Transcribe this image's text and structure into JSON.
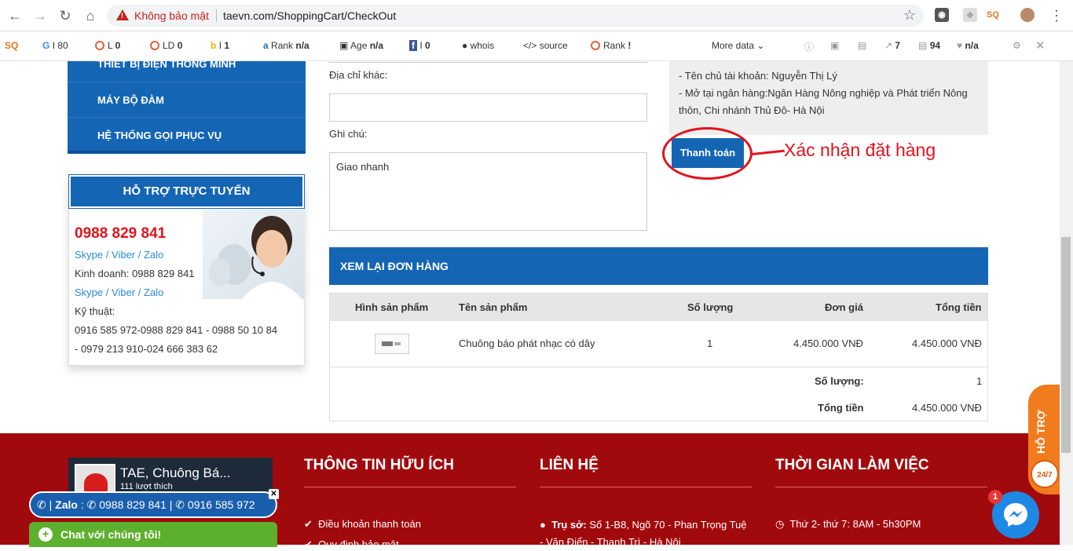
{
  "browser": {
    "insecure_label": "Không bảo mật",
    "url": "taevn.com/ShoppingCart/CheckOut"
  },
  "seo_toolbar": {
    "google": "I 80",
    "links": "L",
    "links_val": "0",
    "ld": "LD",
    "ld_val": "0",
    "bing": "I",
    "bing_val": "1",
    "rank_label": "Rank",
    "rank_val": "n/a",
    "age_label": "Age",
    "age_val": "n/a",
    "fb": "I",
    "fb_val": "0",
    "whois": "whois",
    "source": "source",
    "rank2": "Rank",
    "rank2_val": "!",
    "more": "More data",
    "ext_count": "7",
    "pages": "94",
    "heart": "n/a"
  },
  "sidebar": {
    "menu": [
      "THIẾT BỊ ĐIỆN THÔNG MINH",
      "MÁY BỘ ĐÀM",
      "HỆ THỐNG GỌI PHỤC VỤ"
    ],
    "support_title": "HỖ TRỢ TRỰC TUYẾN",
    "hotline": "0988 829 841",
    "skype": "Skype",
    "viber": "Viber",
    "zalo": "Zalo",
    "slash": "/",
    "sales": "Kinh doanh: 0988 829 841",
    "tech": "Kỹ thuật:",
    "tech_line1": "0916 585 972-0988 829 841 - 0988 50 10 84",
    "tech_line2": "- 0979 213 910-024 666 383 62"
  },
  "form": {
    "other_address_label": "Địa chỉ khác:",
    "other_address_value": "",
    "note_label": "Ghi chú:",
    "note_value": "Giao nhanh"
  },
  "bank": {
    "owner": "- Tên chủ tài khoản: Nguyễn Thị Lý",
    "bank_line1": "- Mở tại ngân hàng:Ngân Hàng Nông nghiệp và Phát triển Nông",
    "bank_line2": "thôn, Chi nhánh Thủ Đô- Hà Nội"
  },
  "pay_button": "Thanh toán",
  "annotation": "Xác nhận đặt hàng",
  "order": {
    "title": "XEM LẠI ĐƠN HÀNG",
    "headers": {
      "image": "Hình sản phẩm",
      "name": "Tên sản phẩm",
      "qty": "Số lượng",
      "price": "Đơn giá",
      "total": "Tổng tiền"
    },
    "rows": [
      {
        "name": "Chuông báo phát nhạc có dây",
        "qty": "1",
        "price": "4.450.000 VNĐ",
        "total": "4.450.000 VNĐ"
      }
    ],
    "summary_qty_label": "Số lượng:",
    "summary_qty": "1",
    "summary_total_label": "Tổng tiền",
    "summary_total": "4.450.000 VNĐ"
  },
  "footer": {
    "fb_name": "TAE, Chuông Bá...",
    "fb_likes": "111 lượt thích",
    "info_title": "THÔNG TIN HỮU ÍCH",
    "info_item1": "Điều khoản thanh toán",
    "info_item2": "Quy định bảo mật",
    "contact_title": "LIÊN HỆ",
    "contact_addr_label": "Trụ sở:",
    "contact_addr1": "Số 1-B8, Ngõ 70 - Phan Trọng Tuệ",
    "contact_addr2": "- Văn Điển - Thanh Trì - Hà Nội",
    "hours_title": "THỜI GIAN LÀM VIỆC",
    "hours_item": "Thứ 2- thứ 7: 8AM - 5h30PM"
  },
  "widgets": {
    "zalo_label": "Zalo",
    "zalo_phone1": "0988 829 841",
    "zalo_phone2": "0916 585 972",
    "zalo_sep": "|",
    "chat": "Chat với chúng tôi!",
    "hotro": "HỖ TRỢ",
    "hotro_247": "24/7",
    "messenger_badge": "1"
  },
  "colors": {
    "brand_blue": "#1565b5",
    "footer_red": "#a10a0d",
    "annotation_red": "#e1141c",
    "hotline_red": "#e1141c"
  }
}
